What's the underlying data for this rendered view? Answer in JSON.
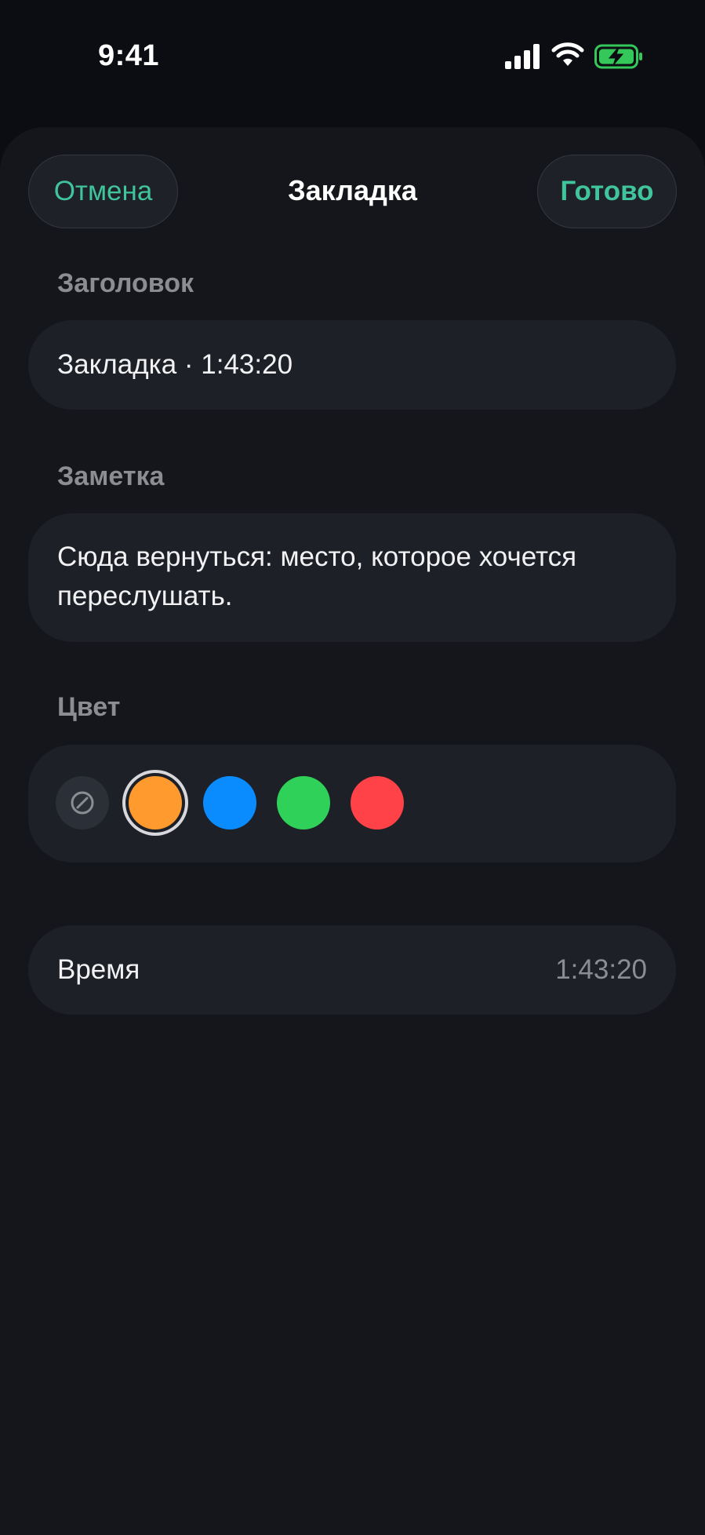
{
  "status_bar": {
    "time": "9:41"
  },
  "header": {
    "cancel_label": "Отмена",
    "title": "Закладка",
    "done_label": "Готово"
  },
  "title_section": {
    "label": "Заголовок",
    "value": "Закладка · 1:43:20"
  },
  "note_section": {
    "label": "Заметка",
    "value_line1": "Сюда вернуться: место, которое хочется",
    "value_line2": "переслушать."
  },
  "color_section": {
    "label": "Цвет",
    "options": [
      {
        "name": "none",
        "color": "#2b2f37"
      },
      {
        "name": "orange",
        "color": "#ff9a2f",
        "selected": true
      },
      {
        "name": "blue",
        "color": "#0a8cff"
      },
      {
        "name": "green",
        "color": "#2fd158"
      },
      {
        "name": "red",
        "color": "#ff4247"
      }
    ]
  },
  "time_row": {
    "label": "Время",
    "value": "1:43:20"
  },
  "colors": {
    "accent": "#3fc49b",
    "background": "#14161b",
    "card": "#1d2026",
    "battery": "#34c759"
  }
}
